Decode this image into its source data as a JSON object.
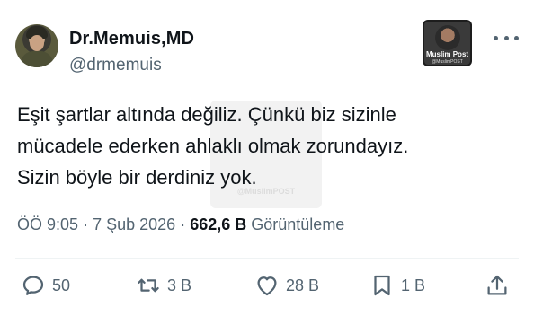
{
  "author": {
    "display_name": "Dr.Memuis,MD",
    "handle": "@drmemuis"
  },
  "badge": {
    "title": "Muslim Post",
    "subtitle": "@MuslimPOST"
  },
  "watermark": "@MuslimPOST",
  "tweet": {
    "lines": [
      "Eşit şartlar altında değiliz. Çünkü biz sizinle",
      "mücadele ederken ahlaklı olmak zorundayız.",
      "Sizin böyle bir derdiniz yok."
    ]
  },
  "meta": {
    "time": "ÖÖ 9:05",
    "date": "7 Şub 2026",
    "sep": "·",
    "views_count": "662,6 B",
    "views_label": "Görüntüleme"
  },
  "actions": {
    "replies": "50",
    "retweets": "3 B",
    "likes": "28 B",
    "bookmarks": "1 B"
  },
  "icons": {
    "reply": "reply-icon",
    "retweet": "retweet-icon",
    "like": "heart-icon",
    "bookmark": "bookmark-icon",
    "share": "share-icon",
    "more": "more-icon"
  },
  "colors": {
    "text": "#0f1419",
    "secondary": "#536471",
    "divider": "#eff3f4"
  }
}
